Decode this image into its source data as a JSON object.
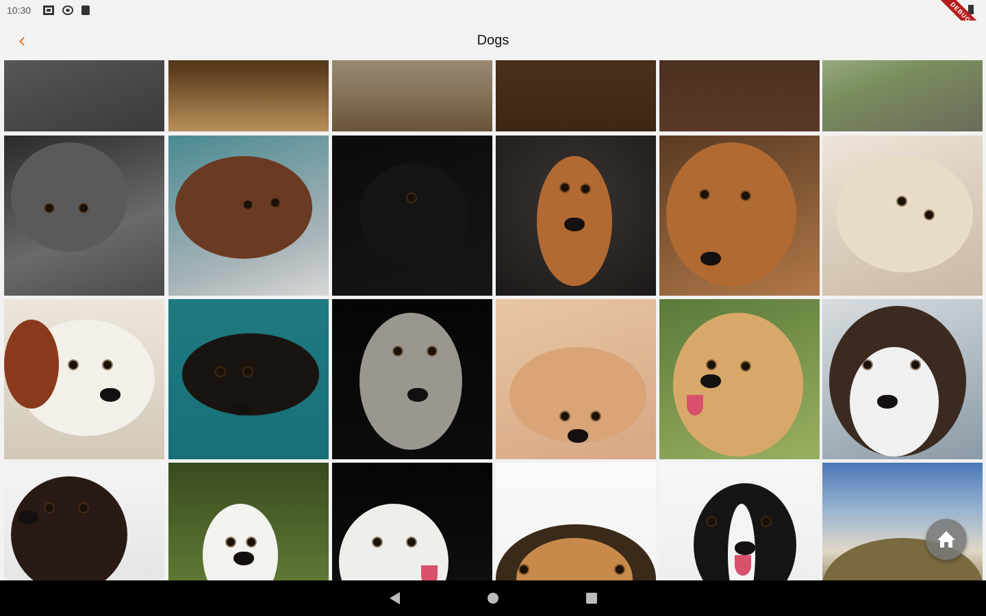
{
  "status_bar": {
    "time": "10:30",
    "left_icons": [
      "storage-icon",
      "sync-icon",
      "sd-card-icon"
    ],
    "right_icons": [
      "wifi-icon",
      "battery-icon"
    ]
  },
  "debug_banner": "DEBUG",
  "app_bar": {
    "back_icon": "chevron-left-icon",
    "title": "Dogs",
    "accent_color": "#e8741e"
  },
  "gallery": {
    "columns": 6,
    "rows": [
      [
        "grey puppy close-up",
        "rottweiler puppies",
        "white dog lying on deck",
        "dark brown background",
        "puppy paws on floor",
        "dog running on path"
      ],
      [
        "grey pitbull lying down",
        "brown shaggy dog on laptop",
        "black labrador profile",
        "vizsla with head tilt",
        "brown dog resting head",
        "shih tzu upside down"
      ],
      [
        "cavalier king charles spaniel",
        "black and tan dachshund",
        "weimaraner portrait",
        "french bulldog lying down",
        "golden retriever",
        "saint bernard in snow"
      ],
      [
        "dog looking out car window",
        "white maltese puppy in grass",
        "dalmatian licking nose",
        "beagle peeking",
        "bernese mountain dog",
        "dog on mountain landscape"
      ]
    ]
  },
  "fab": {
    "icon": "home-icon"
  },
  "nav_bar": {
    "icons": [
      "back-triangle-icon",
      "home-circle-icon",
      "recents-square-icon"
    ]
  }
}
